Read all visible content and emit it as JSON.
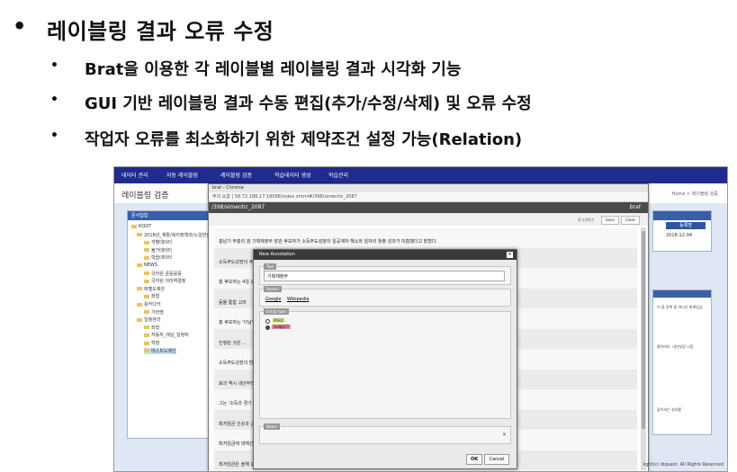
{
  "slide": {
    "title": "레이블링 결과 오류 수정",
    "bullet_marker": "•",
    "sub_marker": "•",
    "bullets": [
      "Brat을 이용한 각 레이블별 레이블링 결과 시각화 기능",
      "GUI 기반 레이블링 결과 수동 편집(추가/수정/삭제) 및 오류 수정",
      "작업자 오류를 최소화하기 위한 제약조건 설정 가능(Relation)"
    ]
  },
  "app": {
    "nav": [
      "데이터 관리",
      "자동 레이블링",
      "레이블링 검증",
      "학습데이터 생성",
      "학습관리"
    ],
    "title": "레이블링 검증",
    "breadcrumb": "Home > 레이블링 검증",
    "tree": {
      "header": "문서집합",
      "items": [
        "ROOT",
        "2018년_재활/복지정책과(노일반)",
        "개별데이터",
        "불가데이터",
        "학습데이터",
        "NEWS",
        "국어원 곰뭉뭉뭉",
        "국어원 의미역결정",
        "레벨도제관",
        "좌형",
        "용카다카",
        "가라명",
        "일정관리",
        "좌형",
        "자동차_레날_일정비",
        "학컴",
        "테스트도메인"
      ]
    },
    "side": {
      "button": "등록명",
      "date": "2018-12-04",
      "header2": "RG"
    },
    "side2_texts": [
      "이 중 정책 중 하나인 회계임금",
      "물어라다. 내년부탕 시장",
      "값어서는 성과를"
    ],
    "footer": "light(c) diquest. All Rights Reserved"
  },
  "chrome": {
    "title": "brat - Chrome",
    "url": "주의 요함 | 58.72.188.17:18088/index.xhtml#/398/simentic_2087"
  },
  "brat": {
    "doc_path": "/398/simentic_2087",
    "brand": "brat",
    "tools": {
      "login": "로그인하기",
      "save": "Save",
      "close": "Close"
    },
    "rows": [
      "홍남기 부총리 겸 기획재정부 장관 후보자가 소득주도성장이 일공계자 해소와 일자리 창출 성과가 미흡했다고 밝혔다.",
      "소득주도성장의 주요 ...",
      "홍 후보자는 4일 오전 ... 이틀간 회로회담대산 관련 인사 ... 하지 않았다 ... 이하는데, 내년부턴 시장 수용성, 지불 여력, 경제 파급력",
      "동물   통합       고려",
      "홍 후보자는 '이날' 소득 ... 서는 성과가 미흡했다'면서 '그동안   할",
      "진행된 것은 ...",
      "소득주도성장의 방향은 ...",
      "효과 역시 내년부터는 ...",
      "그는 '소득과 경기 지표 ... 밝혔다.",
      "최저임금 인상과 근로시간 ...",
      "최저임금에 대해선 ...",
      "최저임금은 올해 16.4% ..."
    ]
  },
  "modal": {
    "title": "New Annotation",
    "close": "×",
    "text_legend": "Text",
    "text_value": "기획재정부",
    "search_legend": "Search",
    "search_links": [
      "Google",
      "Wikipedia"
    ],
    "entity_legend": "Entity type",
    "entity_options": [
      {
        "label": "PRED",
        "selected": false
      },
      {
        "label": "SUBJECT",
        "selected": true
      }
    ],
    "notes_legend": "Notes",
    "notes_clear": "×",
    "ok": "OK",
    "cancel": "Cancel"
  },
  "colors": {
    "nav": "#1f2b8f",
    "panel_head": "#3a5fa8",
    "pred_tag": "#e7ee8a",
    "subject_tag": "#e08aa5"
  }
}
